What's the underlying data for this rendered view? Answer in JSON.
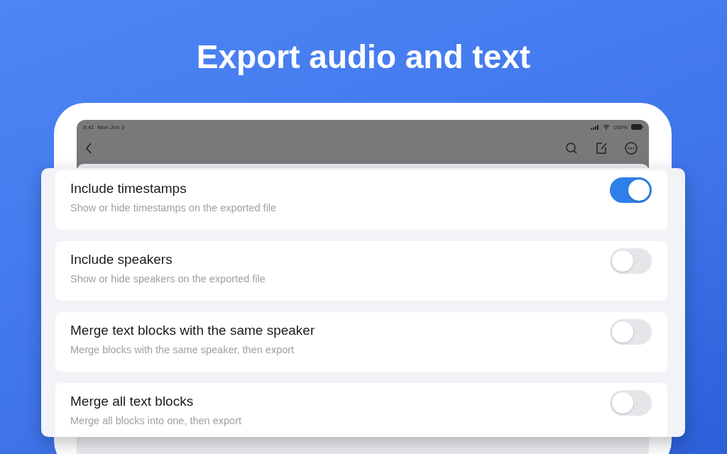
{
  "headline": "Export audio and text",
  "status_bar": {
    "time": "9:41",
    "date": "Mon Jun 3",
    "battery": "100%"
  },
  "settings": [
    {
      "title": "Include timestamps",
      "description": "Show or hide timestamps on the exported file",
      "on": true
    },
    {
      "title": "Include speakers",
      "description": "Show or hide speakers on the exported file",
      "on": false
    },
    {
      "title": "Merge text blocks with the same speaker",
      "description": "Merge blocks with the same speaker, then export",
      "on": false
    },
    {
      "title": "Merge all text blocks",
      "description": "Merge all blocks into one, then export",
      "on": false
    }
  ]
}
